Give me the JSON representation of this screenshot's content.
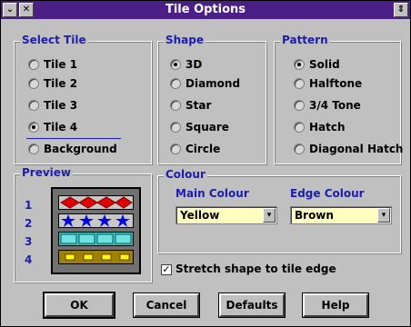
{
  "window": {
    "title": "Tile Options"
  },
  "select_tile": {
    "label": "Select Tile",
    "options": [
      {
        "text": "Tile 1",
        "selected": false
      },
      {
        "text": "Tile 2",
        "selected": false
      },
      {
        "text": "Tile 3",
        "selected": false
      },
      {
        "text": "Tile 4",
        "selected": true
      },
      {
        "text": "Background",
        "selected": false
      }
    ]
  },
  "shape": {
    "label": "Shape",
    "options": [
      {
        "text": "3D",
        "selected": true
      },
      {
        "text": "Diamond",
        "selected": false
      },
      {
        "text": "Star",
        "selected": false
      },
      {
        "text": "Square",
        "selected": false
      },
      {
        "text": "Circle",
        "selected": false
      }
    ]
  },
  "pattern": {
    "label": "Pattern",
    "options": [
      {
        "text": "Solid",
        "selected": true
      },
      {
        "text": "Halftone",
        "selected": false
      },
      {
        "text": "3/4 Tone",
        "selected": false
      },
      {
        "text": "Hatch",
        "selected": false
      },
      {
        "text": "Diagonal Hatch",
        "selected": false
      }
    ]
  },
  "preview": {
    "label": "Preview",
    "rows": [
      "1",
      "2",
      "3",
      "4"
    ]
  },
  "colour": {
    "label": "Colour",
    "main_label": "Main Colour",
    "main_value": "Yellow",
    "edge_label": "Edge Colour",
    "edge_value": "Brown"
  },
  "stretch": {
    "label": "Stretch shape to tile edge",
    "checked": true
  },
  "buttons": {
    "ok": "OK",
    "cancel": "Cancel",
    "defaults": "Defaults",
    "help": "Help"
  },
  "colors": {
    "title_bar": "#4a1f86",
    "group_label": "#1c1cb0",
    "combo_bg": "#ffffc0"
  }
}
